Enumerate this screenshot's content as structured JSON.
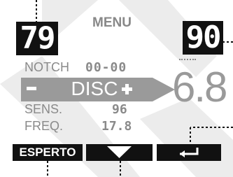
{
  "header": {
    "title": "MENU",
    "left_value": "79",
    "right_value": "90"
  },
  "menu": {
    "notch": {
      "label": "NOTCH",
      "value": "00-00"
    },
    "disc": {
      "label": "DISC",
      "decrease": "-",
      "increase": "+"
    },
    "sens": {
      "label": "SENS.",
      "value": "96"
    },
    "freq": {
      "label": "FREQ.",
      "value": "17.8"
    }
  },
  "display": {
    "value": "6.8"
  },
  "softkeys": {
    "left_label": "ESPERTO",
    "center_icon": "down-arrow-icon",
    "right_icon": "back-arrow-icon"
  },
  "colors": {
    "screen_black": "#111111",
    "text_grey": "#8a8a8a",
    "highlight_grey": "#9a9a9a"
  }
}
